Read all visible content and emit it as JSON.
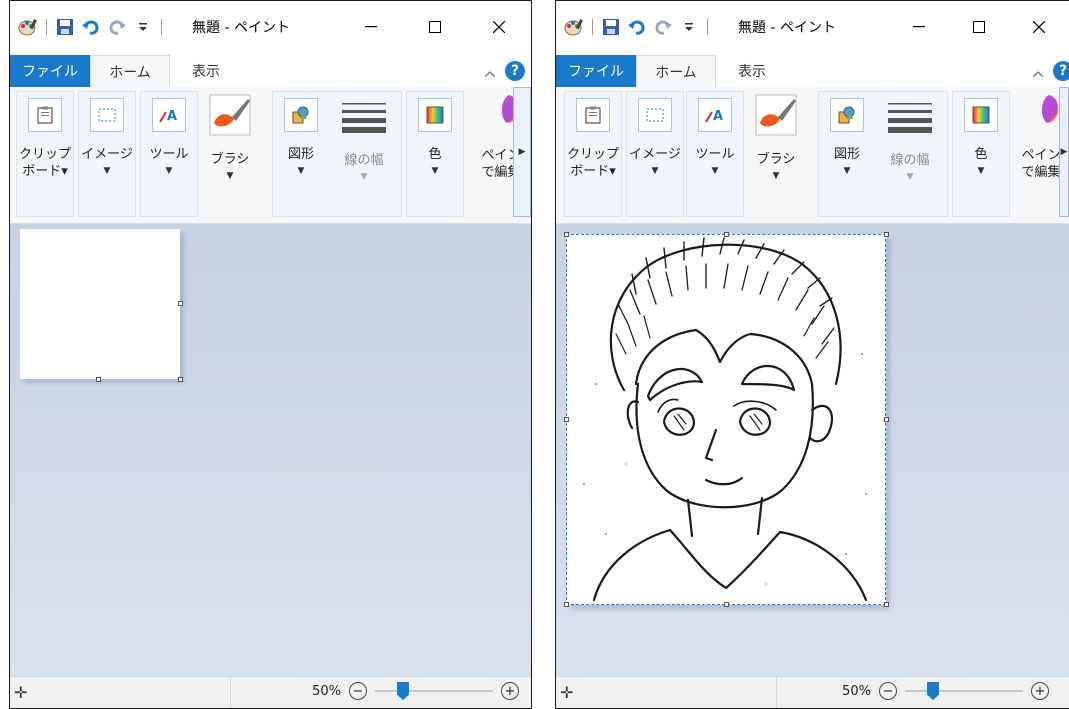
{
  "window": {
    "title": "無題 - ペイント",
    "tabs": {
      "file": "ファイル",
      "home": "ホーム",
      "view": "表示"
    },
    "help": "?",
    "ribbon": {
      "clipboard": "クリップ\nボード▾",
      "image": "イメージ",
      "tools": "ツール",
      "brushes": "ブラシ",
      "shapes": "図形",
      "size": "線の幅",
      "colors": "色",
      "paint3d": "ペイン\nで編集"
    },
    "status": {
      "zoom": "50%"
    }
  },
  "zoom_fraction": 0.21,
  "colors": {
    "accent": "#1979ca",
    "workspace": "#c6d1e2"
  }
}
